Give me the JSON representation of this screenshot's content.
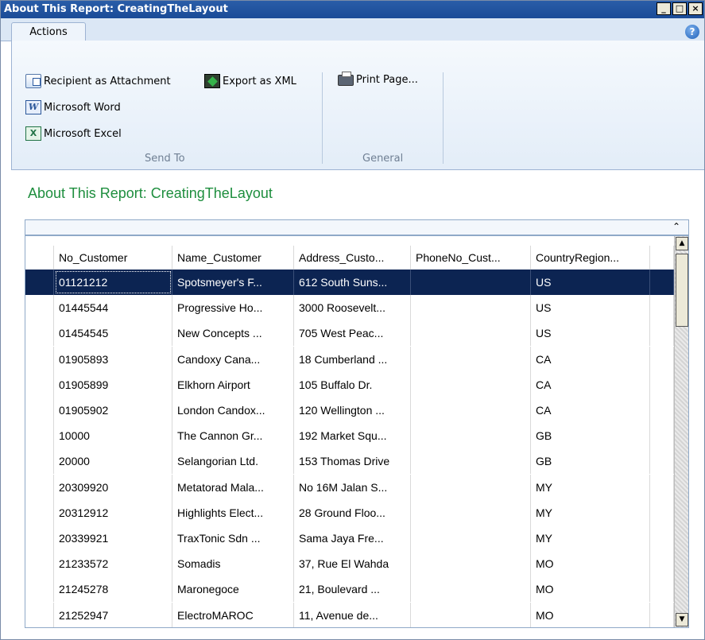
{
  "window": {
    "title": "About This Report: CreatingTheLayout",
    "minimize": "_",
    "maximize": "□",
    "close": "×"
  },
  "ribbon": {
    "tab": "Actions",
    "help": "?",
    "send_to": {
      "label": "Send To",
      "recipient": "Recipient as Attachment",
      "export_xml": "Export as XML",
      "word": "Microsoft Word",
      "excel": "Microsoft Excel"
    },
    "general": {
      "label": "General",
      "print": "Print Page..."
    }
  },
  "report": {
    "title": "About This Report: CreatingTheLayout"
  },
  "grid": {
    "collapse_icon": "⌃",
    "columns": [
      "No_Customer",
      "Name_Customer",
      "Address_Custo...",
      "PhoneNo_Cust...",
      "CountryRegion..."
    ],
    "rows": [
      [
        "01121212",
        "Spotsmeyer's F...",
        "612 South Suns...",
        "",
        "US"
      ],
      [
        "01445544",
        "Progressive Ho...",
        "3000 Roosevelt...",
        "",
        "US"
      ],
      [
        "01454545",
        "New Concepts ...",
        "705 West Peac...",
        "",
        "US"
      ],
      [
        "01905893",
        "Candoxy Cana...",
        "18 Cumberland ...",
        "",
        "CA"
      ],
      [
        "01905899",
        "Elkhorn Airport",
        "105 Buffalo Dr.",
        "",
        "CA"
      ],
      [
        "01905902",
        "London Candox...",
        "120 Wellington ...",
        "",
        "CA"
      ],
      [
        "10000",
        "The Cannon Gr...",
        "192 Market Squ...",
        "",
        "GB"
      ],
      [
        "20000",
        "Selangorian Ltd.",
        "153 Thomas Drive",
        "",
        "GB"
      ],
      [
        "20309920",
        "Metatorad Mala...",
        "No 16M Jalan S...",
        "",
        "MY"
      ],
      [
        "20312912",
        "Highlights Elect...",
        "28 Ground Floo...",
        "",
        "MY"
      ],
      [
        "20339921",
        "TraxTonic Sdn ...",
        "Sama Jaya Fre...",
        "",
        "MY"
      ],
      [
        "21233572",
        "Somadis",
        "37, Rue El Wahda",
        "",
        "MO"
      ],
      [
        "21245278",
        "Maronegoce",
        "21, Boulevard ...",
        "",
        "MO"
      ],
      [
        "21252947",
        "ElectroMAROC",
        "11, Avenue de...",
        "",
        "MO"
      ]
    ],
    "selected_row": 0
  },
  "colors": {
    "title_bar": "#1f55a3",
    "selection": "#0c2452",
    "report_title": "#1e8e3e"
  }
}
